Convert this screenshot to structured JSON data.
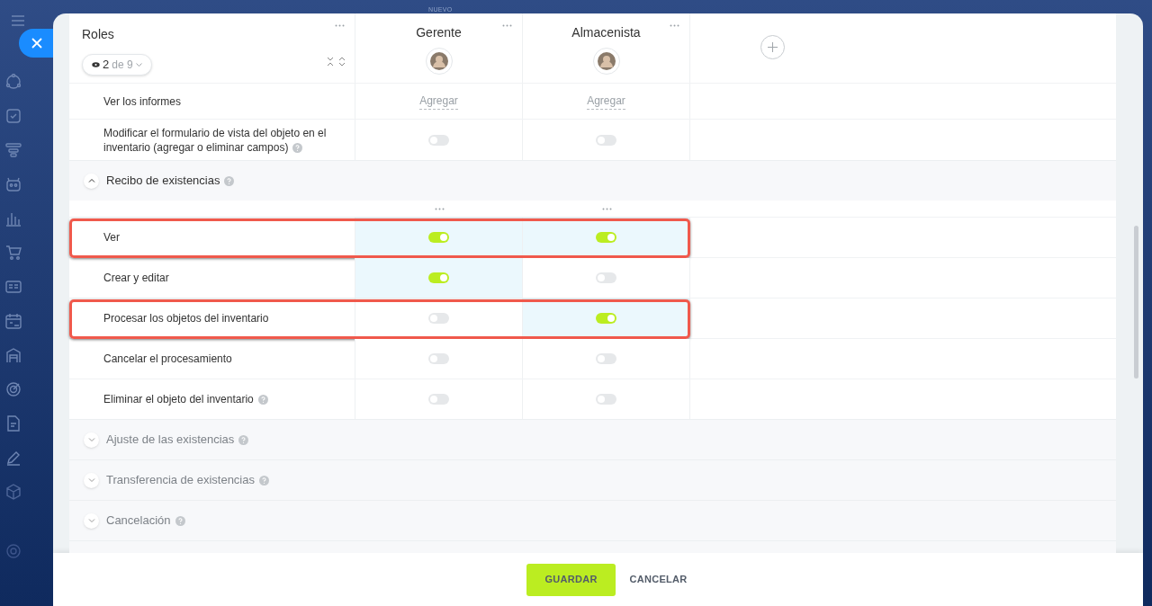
{
  "background_label": "NUEVO",
  "roles_header": {
    "title": "Roles",
    "filter": {
      "count": "2",
      "total": "de 9"
    }
  },
  "columns": [
    {
      "name": "Gerente"
    },
    {
      "name": "Almacenista"
    }
  ],
  "rows": [
    {
      "kind": "link",
      "label": "Ver los informes",
      "help": false,
      "highlighted": false,
      "cells": [
        "Agregar",
        "Agregar"
      ]
    },
    {
      "kind": "toggle",
      "label": "Modificar el formulario de vista del objeto en el inventario (agregar o eliminar campos)",
      "help": true,
      "highlighted": false,
      "cells": [
        {
          "on": false
        },
        {
          "on": false
        }
      ]
    },
    {
      "kind": "group",
      "label": "Recibo de existencias",
      "help": true,
      "expanded": true
    },
    {
      "kind": "toggle",
      "label": "Ver",
      "help": false,
      "highlighted": true,
      "cells": [
        {
          "on": true
        },
        {
          "on": true
        }
      ]
    },
    {
      "kind": "toggle",
      "label": "Crear y editar",
      "help": false,
      "highlighted": false,
      "cells": [
        {
          "on": true
        },
        {
          "on": false
        }
      ]
    },
    {
      "kind": "toggle",
      "label": "Procesar los objetos del inventario",
      "help": false,
      "highlighted": true,
      "cells": [
        {
          "on": false
        },
        {
          "on": true
        }
      ]
    },
    {
      "kind": "toggle",
      "label": "Cancelar el procesamiento",
      "help": false,
      "highlighted": false,
      "cells": [
        {
          "on": false
        },
        {
          "on": false
        }
      ]
    },
    {
      "kind": "toggle",
      "label": "Eliminar el objeto del inventario",
      "help": true,
      "highlighted": false,
      "cells": [
        {
          "on": false
        },
        {
          "on": false
        }
      ]
    },
    {
      "kind": "group",
      "label": "Ajuste de las existencias",
      "help": true,
      "expanded": false
    },
    {
      "kind": "group",
      "label": "Transferencia de existencias",
      "help": true,
      "expanded": false
    },
    {
      "kind": "group",
      "label": "Cancelación",
      "help": true,
      "expanded": false
    }
  ],
  "footer_buttons": [
    {
      "kind": "primary",
      "label": "GUARDAR"
    },
    {
      "kind": "secondary",
      "label": "CANCELAR"
    }
  ]
}
